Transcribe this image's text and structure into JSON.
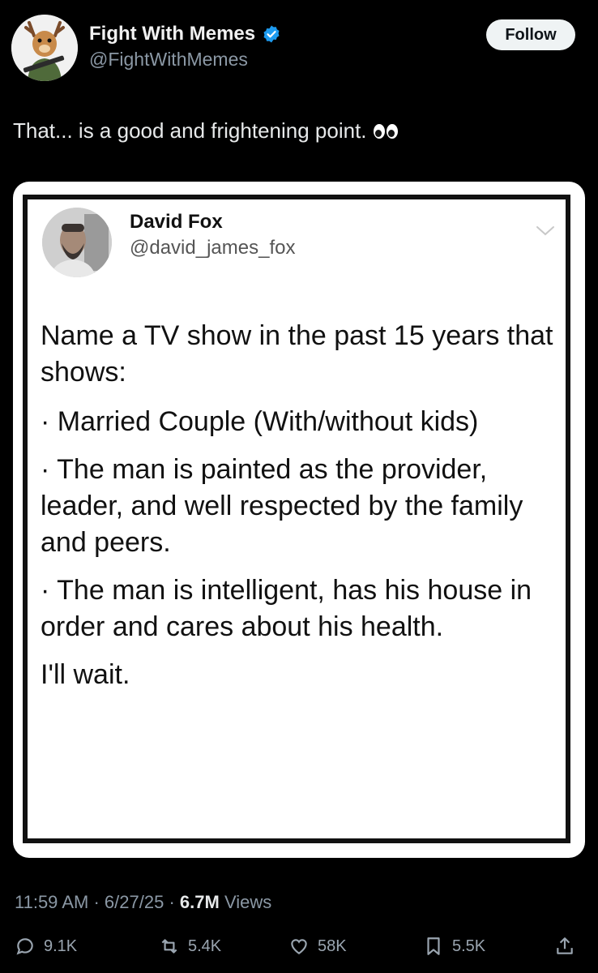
{
  "author": {
    "display_name": "Fight With Memes",
    "handle": "@FightWithMemes",
    "follow_label": "Follow"
  },
  "tweet": {
    "text": "That... is a good and frightening point."
  },
  "quoted": {
    "display_name": "David Fox",
    "handle": "@david_james_fox",
    "paragraphs": [
      "Name a TV show in the past 15 years that shows:",
      "· Married Couple (With/without kids)",
      "· The man is painted as the provider, leader, and well respected by the family and peers.",
      "· The man is intelligent, has his house in order and cares about his health.",
      "I'll wait."
    ]
  },
  "meta": {
    "time": "11:59 AM",
    "date": "6/27/25",
    "views_count": "6.7M",
    "views_label": "Views"
  },
  "actions": {
    "replies": "9.1K",
    "reposts": "5.4K",
    "likes": "58K",
    "bookmarks": "5.5K"
  },
  "icons": [
    "verified-badge-icon",
    "eyes-emoji-icon",
    "chevron-down-icon",
    "reply-icon",
    "repost-icon",
    "like-icon",
    "bookmark-icon",
    "share-icon"
  ],
  "colors": {
    "background": "#000000",
    "verified": "#1d9bf0",
    "muted": "#8b98a5"
  }
}
